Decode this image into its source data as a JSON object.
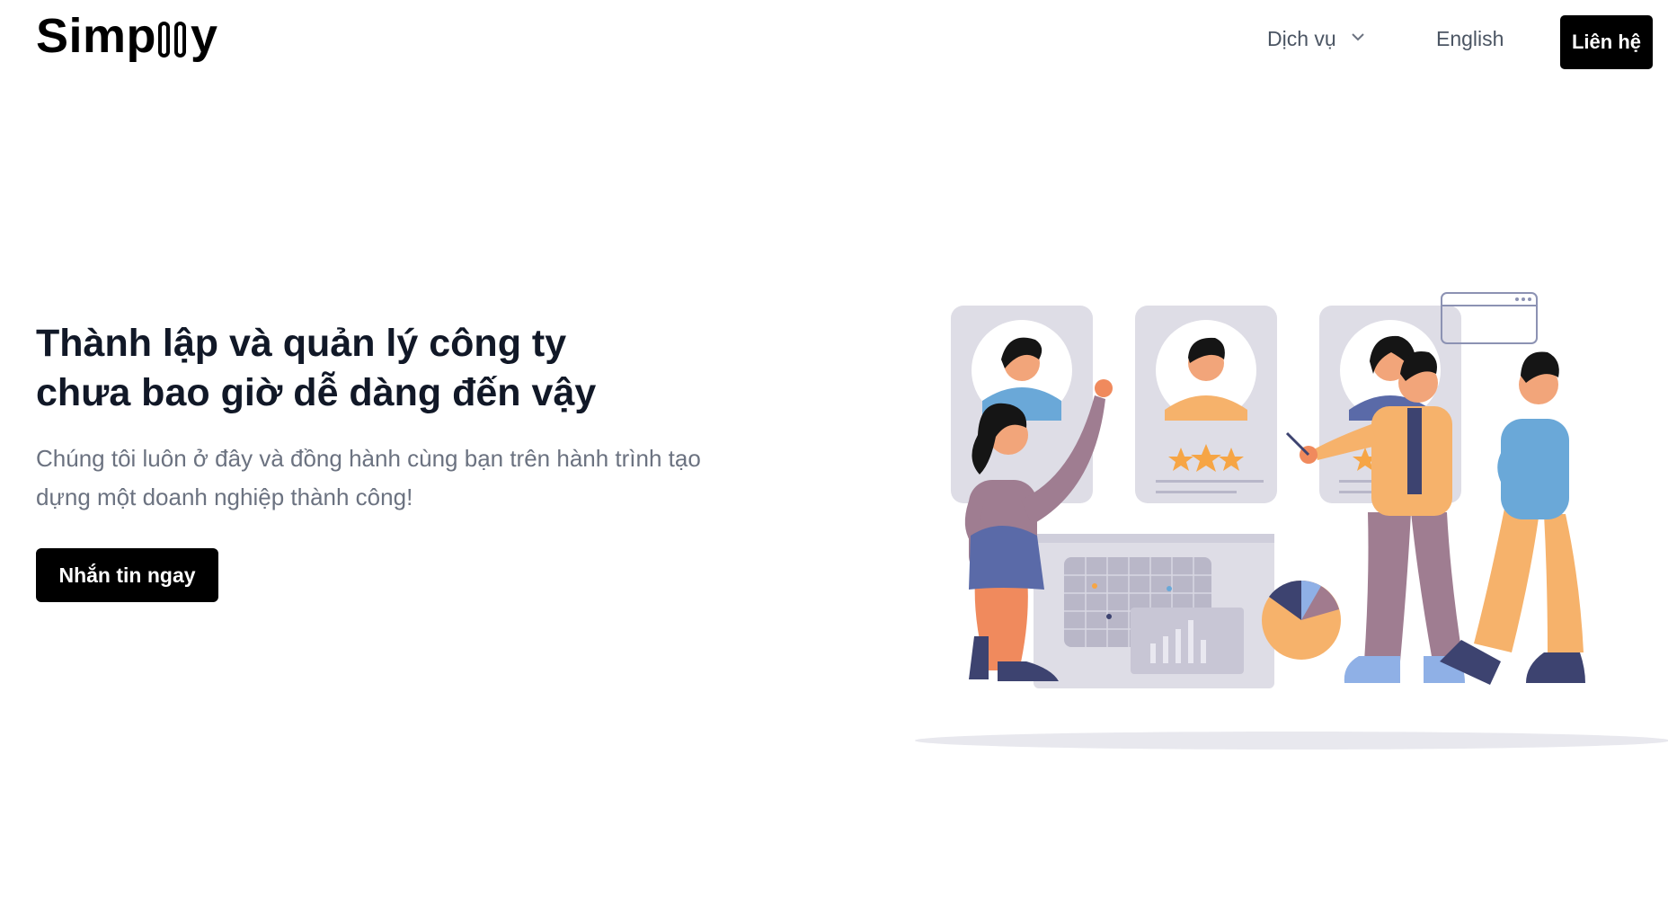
{
  "header": {
    "logo_text": "Simp▯▯y",
    "nav": {
      "services_label": "Dịch vụ",
      "language_label": "English",
      "contact_label": "Liên hệ"
    }
  },
  "hero": {
    "title_line1": "Thành lập và quản lý công ty",
    "title_line2": "chưa bao giờ dễ dàng đến vậy",
    "subtitle_line1": "Chúng tôi luôn ở đây và đồng hành cùng bạn trên hành trình tạo",
    "subtitle_line2": "dựng một doanh nghiệp thành công!",
    "cta_label": "Nhắn tin ngay"
  },
  "colors": {
    "primary": "#000000",
    "text": "#111827",
    "muted": "#6b7280"
  },
  "icons": {
    "services_dropdown": "chevron-down-icon"
  }
}
